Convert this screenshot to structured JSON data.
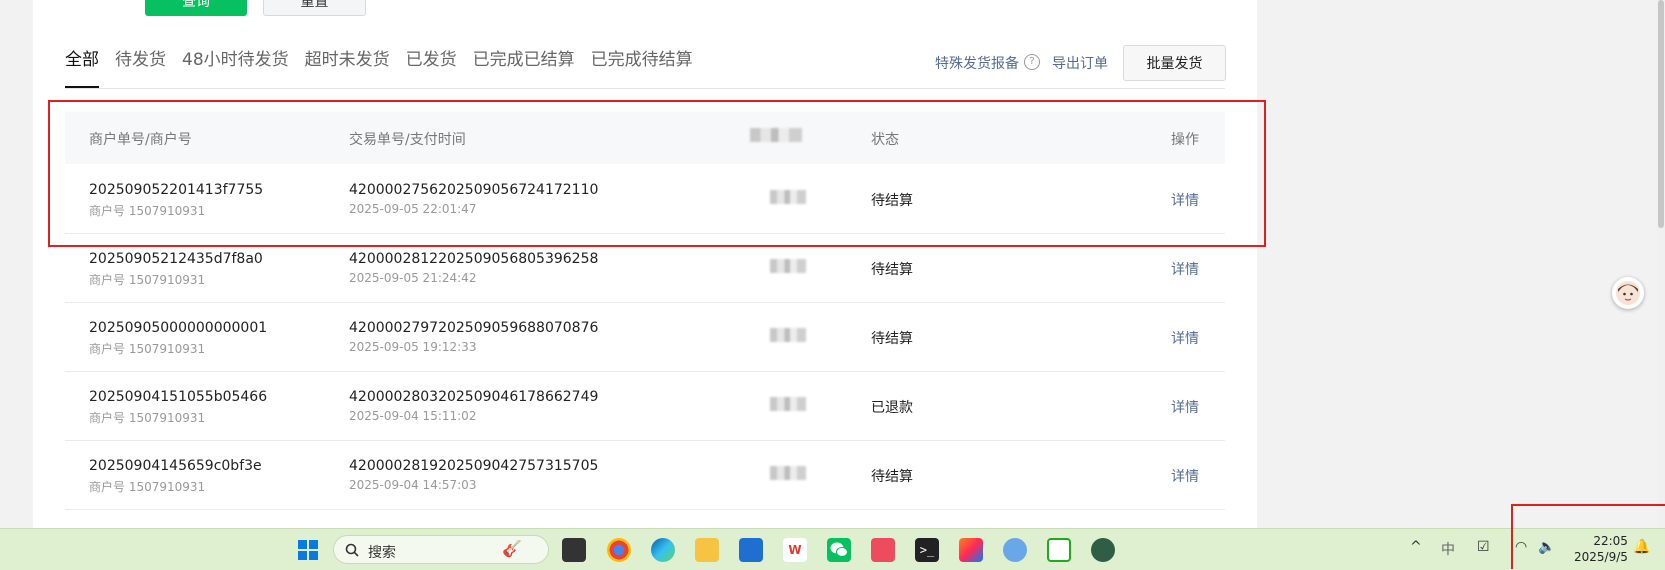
{
  "top_buttons": {
    "query": "查询",
    "reset": "重置"
  },
  "tabs": [
    "全部",
    "待发货",
    "48小时待发货",
    "超时未发货",
    "已发货",
    "已完成已结算",
    "已完成待结算"
  ],
  "right_links": {
    "special": "特殊发货报备",
    "export": "导出订单",
    "batch": "批量发货"
  },
  "table": {
    "headers": {
      "merchant": "商户单号/商户号",
      "trade": "交易单号/支付时间",
      "status": "状态",
      "action": "操作"
    },
    "rows": [
      {
        "order": "202509052201413f7755",
        "merchant": "商户号 1507910931",
        "trade": "4200002756202509056724172110",
        "time": "2025-09-05 22:01:47",
        "status": "待结算",
        "action": "详情"
      },
      {
        "order": "20250905212435d7f8a0",
        "merchant": "商户号 1507910931",
        "trade": "4200002812202509056805396258",
        "time": "2025-09-05 21:24:42",
        "status": "待结算",
        "action": "详情"
      },
      {
        "order": "20250905000000000001",
        "merchant": "商户号 1507910931",
        "trade": "4200002797202509059688070876",
        "time": "2025-09-05 19:12:33",
        "status": "待结算",
        "action": "详情"
      },
      {
        "order": "20250904151055b05466",
        "merchant": "商户号 1507910931",
        "trade": "4200002803202509046178662749",
        "time": "2025-09-04 15:11:02",
        "status": "已退款",
        "action": "详情"
      },
      {
        "order": "20250904145659c0bf3e",
        "merchant": "商户号 1507910931",
        "trade": "4200002819202509042757315705",
        "time": "2025-09-04 14:57:03",
        "status": "待结算",
        "action": "详情"
      }
    ]
  },
  "taskbar": {
    "search_placeholder": "搜索",
    "ime": "中",
    "time": "22:05",
    "date": "2025/9/5"
  },
  "colors": {
    "accent": "#07c160",
    "link": "#576b95",
    "highlight": "#e02020"
  }
}
